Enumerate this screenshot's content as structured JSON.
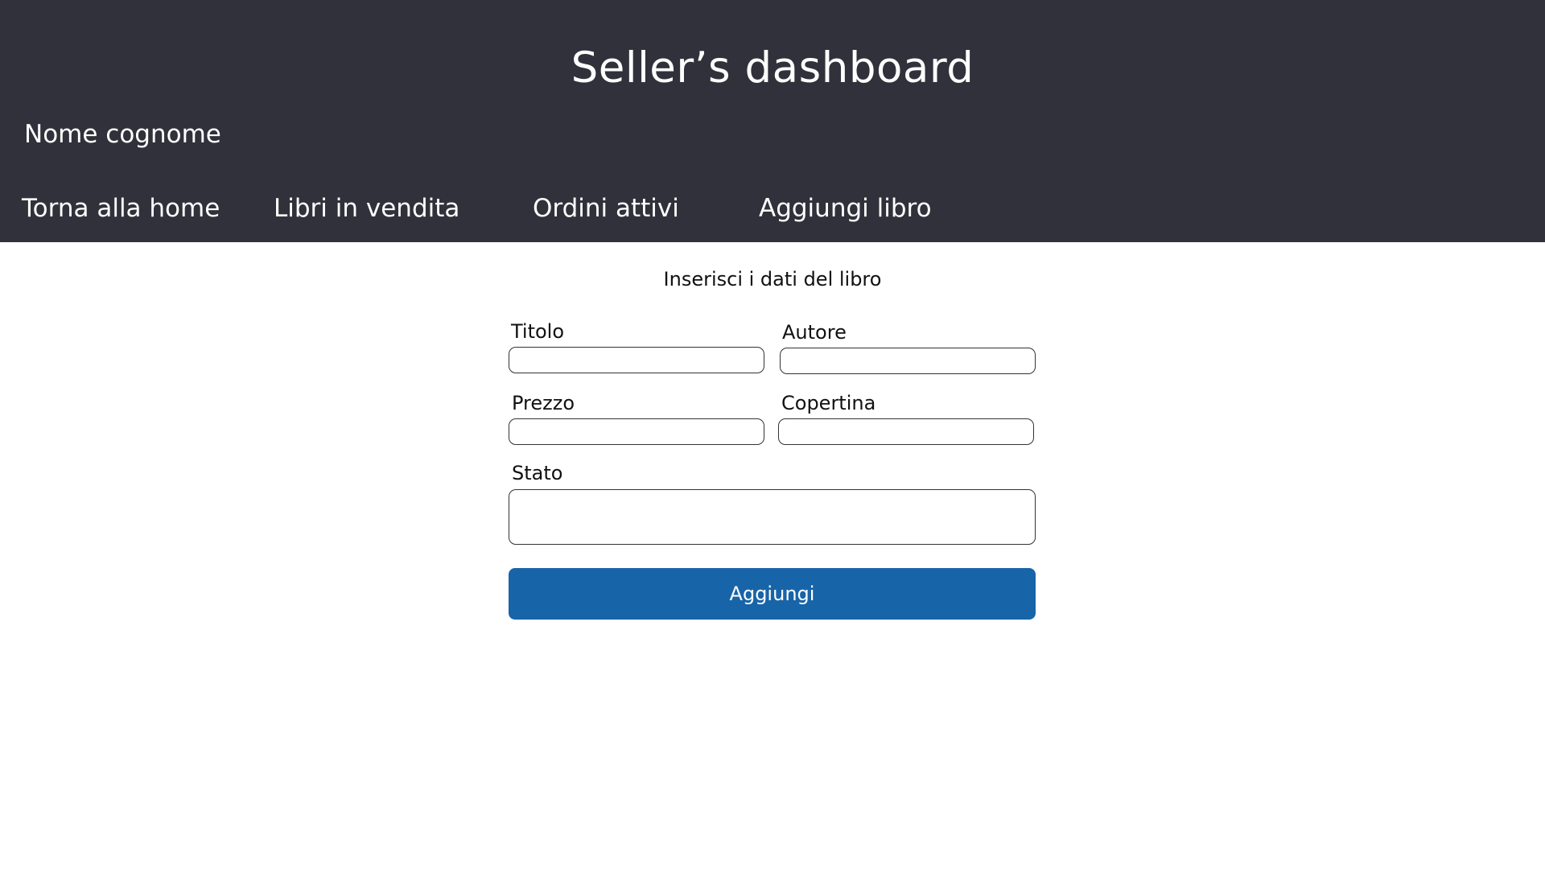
{
  "header": {
    "title": "Seller’s dashboard",
    "user_name": "Nome cognome",
    "nav": {
      "home": "Torna alla home",
      "selling": "Libri in vendita",
      "orders": "Ordini attivi",
      "add": "Aggiungi libro"
    }
  },
  "form": {
    "heading": "Inserisci i dati del libro",
    "fields": {
      "titolo": {
        "label": "Titolo",
        "value": ""
      },
      "autore": {
        "label": "Autore",
        "value": ""
      },
      "prezzo": {
        "label": "Prezzo",
        "value": ""
      },
      "copertina": {
        "label": "Copertina",
        "value": ""
      },
      "stato": {
        "label": "Stato",
        "value": ""
      }
    },
    "submit_label": "Aggiungi"
  },
  "colors": {
    "header_bg": "#31313b",
    "accent": "#1864a8"
  }
}
